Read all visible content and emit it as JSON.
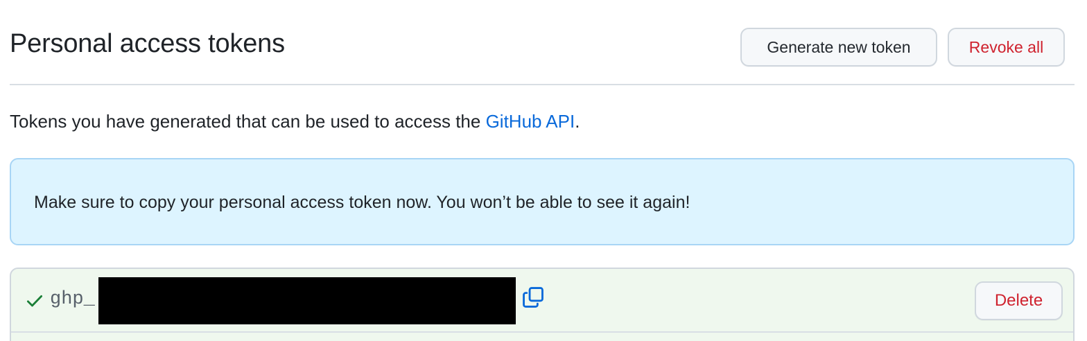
{
  "header": {
    "title": "Personal access tokens",
    "generate_label": "Generate new token",
    "revoke_label": "Revoke all"
  },
  "description": {
    "text_before": "Tokens you have generated that can be used to access the ",
    "link_text": "GitHub API",
    "text_after": "."
  },
  "flash": {
    "message": "Make sure to copy your personal access token now. You won’t be able to see it again!"
  },
  "token": {
    "prefix": "ghp_",
    "status_icon": "check-icon",
    "copy_icon": "copy-icon",
    "delete_label": "Delete"
  },
  "colors": {
    "link": "#0969da",
    "danger": "#cf222e",
    "success": "#1a7f37",
    "flash_bg": "#ddf4ff",
    "token_row_bg": "#eff8ee"
  }
}
